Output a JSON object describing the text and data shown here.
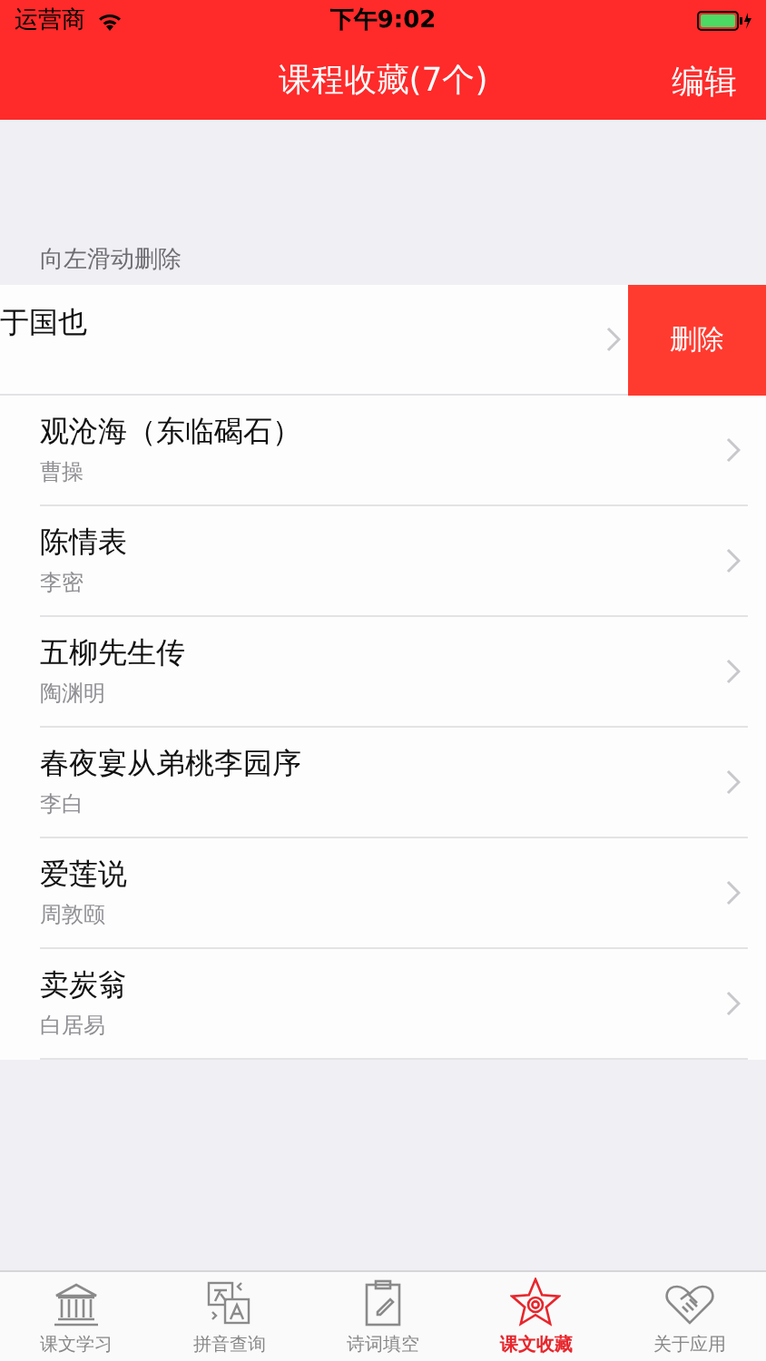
{
  "status_bar": {
    "carrier": "运营商",
    "time": "下午9:02"
  },
  "nav": {
    "title": "课程收藏(7个)",
    "action": "编辑"
  },
  "section_header": "向左滑动删除",
  "rows": [
    {
      "title": "于国也",
      "swiped": true,
      "action": "删除"
    },
    {
      "title": "观沧海（东临碣石）",
      "subtitle": "曹操",
      "swiped": false
    },
    {
      "title": "陈情表",
      "subtitle": "李密",
      "swiped": false
    },
    {
      "title": "五柳先生传",
      "subtitle": "陶渊明",
      "swiped": false
    },
    {
      "title": "春夜宴从弟桃李园序",
      "subtitle": "李白",
      "swiped": false
    },
    {
      "title": "爱莲说",
      "subtitle": "周敦颐",
      "swiped": false
    },
    {
      "title": "卖炭翁",
      "subtitle": "白居易",
      "swiped": false
    }
  ],
  "tabs": [
    {
      "label": "课文学习",
      "selected": false
    },
    {
      "label": "拼音查询",
      "selected": false
    },
    {
      "label": "诗词填空",
      "selected": false
    },
    {
      "label": "课文收藏",
      "selected": true
    },
    {
      "label": "关于应用",
      "selected": false
    }
  ]
}
